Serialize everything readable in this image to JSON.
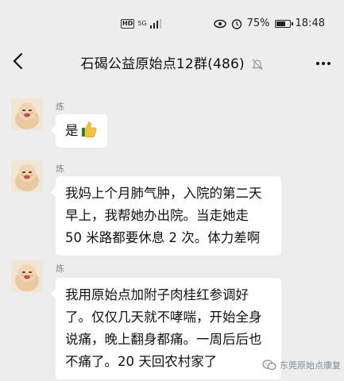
{
  "status_bar": {
    "hd": "HD",
    "network": "5G",
    "battery_percent": "75%",
    "battery_level": 0.75,
    "time": "18:48"
  },
  "header": {
    "title": "石碣公益原始点12群(486)",
    "back_icon": "chevron-left-icon",
    "mute_icon": "bell-off-icon",
    "more_icon": "more-dots-icon"
  },
  "messages": [
    {
      "sender": "炼",
      "lines": [
        "是"
      ],
      "emoji": "thumbs-up"
    },
    {
      "sender": "炼",
      "lines": [
        "我妈上个月肺气肿，入院的第二天",
        "早上，我帮她办出院。当走她走",
        "50 米路都要休息 2 次。体力差啊"
      ]
    },
    {
      "sender": "炼",
      "lines": [
        "我用原始点加附子肉桂红参调好",
        "了。仅仅几天就不哮喘，开始全身",
        "说痛，晚上翻身都痛。一周后后也",
        "不痛了。20 天回农村家了"
      ]
    }
  ],
  "watermark": {
    "text": "东莞原始点康复",
    "icon": "wechat-icon"
  }
}
